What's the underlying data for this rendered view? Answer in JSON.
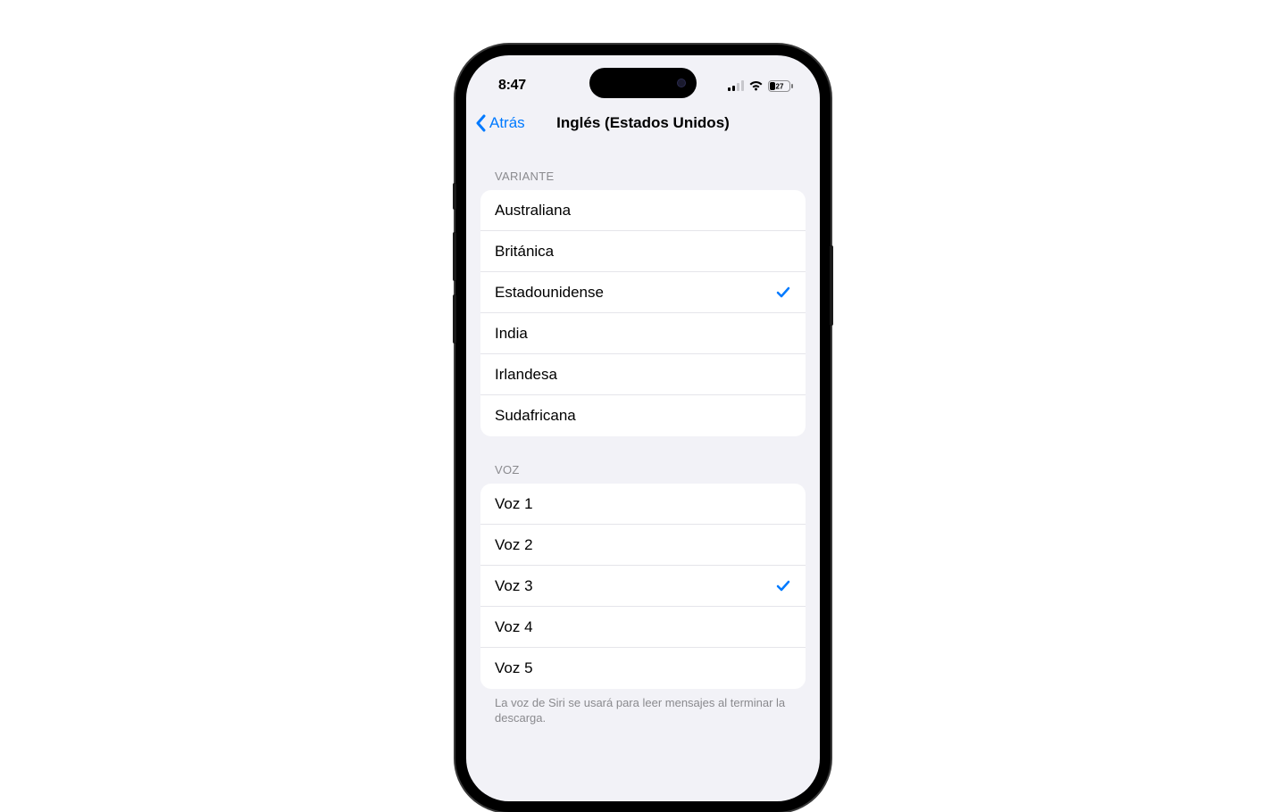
{
  "status": {
    "time": "8:47",
    "battery_pct": "27"
  },
  "nav": {
    "back_label": "Atrás",
    "title": "Inglés (Estados Unidos)"
  },
  "sections": {
    "variant": {
      "header": "VARIANTE",
      "items": [
        {
          "label": "Australiana",
          "selected": false
        },
        {
          "label": "Británica",
          "selected": false
        },
        {
          "label": "Estadounidense",
          "selected": true
        },
        {
          "label": "India",
          "selected": false
        },
        {
          "label": "Irlandesa",
          "selected": false
        },
        {
          "label": "Sudafricana",
          "selected": false
        }
      ]
    },
    "voice": {
      "header": "VOZ",
      "items": [
        {
          "label": "Voz 1",
          "selected": false
        },
        {
          "label": "Voz 2",
          "selected": false
        },
        {
          "label": "Voz 3",
          "selected": true
        },
        {
          "label": "Voz 4",
          "selected": false
        },
        {
          "label": "Voz 5",
          "selected": false
        }
      ],
      "footer": "La voz de Siri se usará para leer mensajes al terminar la descarga."
    }
  }
}
